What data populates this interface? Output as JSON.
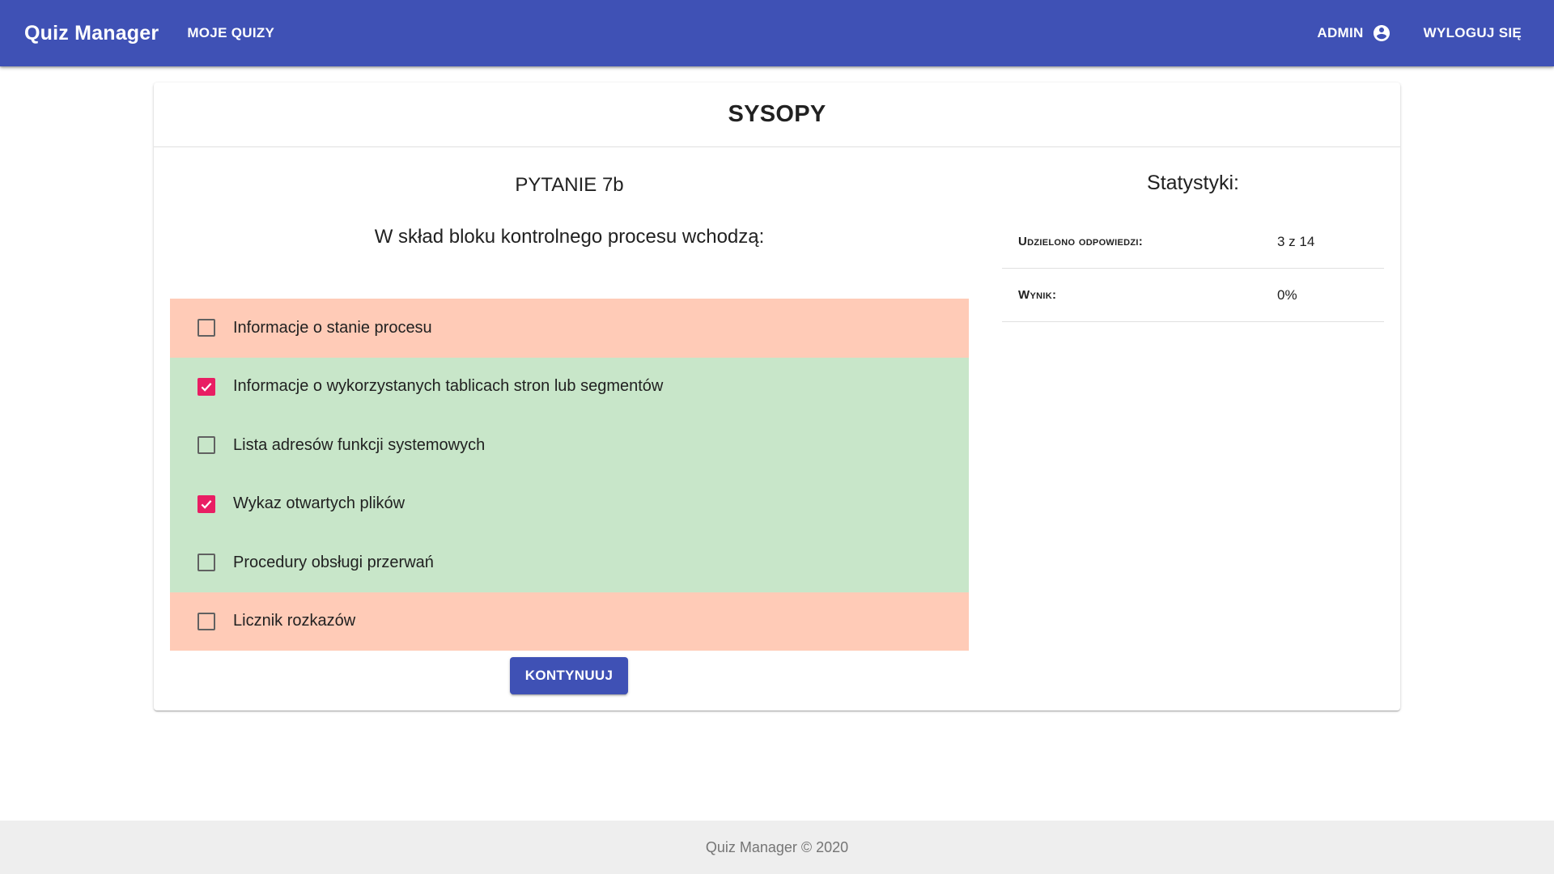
{
  "header": {
    "brand": "Quiz Manager",
    "my_quizzes": "MOJE QUIZY",
    "user": "ADMIN",
    "user_icon": "account-circle-icon",
    "logout": "WYLOGUJ SIĘ",
    "color": "#3f51b5"
  },
  "quiz": {
    "title": "SYSOPY",
    "question_number": "PYTANIE 7b",
    "question_text": "W skład bloku kontrolnego procesu wchodzą:",
    "answers": [
      {
        "label": "Informacje o stanie procesu",
        "checked": false,
        "status": "wrong"
      },
      {
        "label": "Informacje o wykorzystanych tablicach stron lub segmentów",
        "checked": true,
        "status": "correct"
      },
      {
        "label": "Lista adresów funkcji systemowych",
        "checked": false,
        "status": "correct"
      },
      {
        "label": "Wykaz otwartych plików",
        "checked": true,
        "status": "correct"
      },
      {
        "label": "Procedury obsługi przerwań",
        "checked": false,
        "status": "correct"
      },
      {
        "label": "Licznik rozkazów",
        "checked": false,
        "status": "wrong"
      }
    ],
    "continue_label": "KONTYNUUJ"
  },
  "stats": {
    "title": "Statystyki:",
    "rows": [
      {
        "label": "Udzielono odpowiedzi:",
        "value": "3 z 14"
      },
      {
        "label": "Wynik:",
        "value": "0%"
      }
    ]
  },
  "footer": {
    "text": "Quiz Manager © 2020"
  },
  "colors": {
    "correct_bg": "#c8e6c9",
    "wrong_bg": "#ffcbb7",
    "checkbox_checked": "#e91e63"
  }
}
